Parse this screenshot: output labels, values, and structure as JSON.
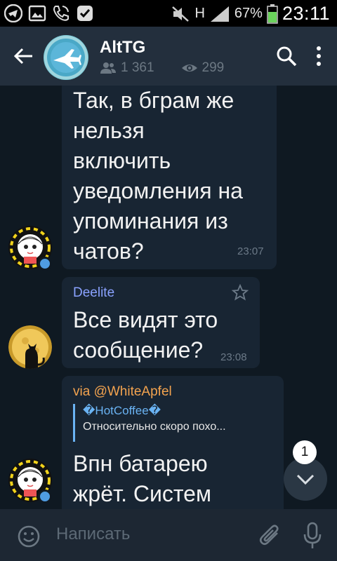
{
  "status_bar": {
    "battery_percent": "67%",
    "time": "23:11",
    "network_label": "H"
  },
  "header": {
    "channel_name": "AltTG",
    "members_count": "1 361",
    "views_count": "299"
  },
  "messages": [
    {
      "text_lines": [
        "Так, в бграм же",
        "нельзя",
        "включить",
        "уведомления на",
        "упоминания из",
        "чатов?"
      ],
      "time": "23:07"
    },
    {
      "author": "Deelite",
      "text_lines": [
        "Все видят это",
        "сообщение?"
      ],
      "time": "23:08"
    },
    {
      "via": "via @WhiteApfel",
      "reply_name": "�HotCoffee�",
      "reply_text": "Относительно скоро похо...",
      "text_lines": [
        "Впн батарею",
        "жрёт. Систем"
      ]
    }
  ],
  "scroll_down": {
    "unread_count": "1"
  },
  "composer": {
    "placeholder": "Написать"
  },
  "colors": {
    "accent": "#6ab3f3",
    "author_name": "#8aa2ff",
    "via_name": "#f3a34f",
    "bubble": "#182533",
    "background": "#0f1922"
  }
}
